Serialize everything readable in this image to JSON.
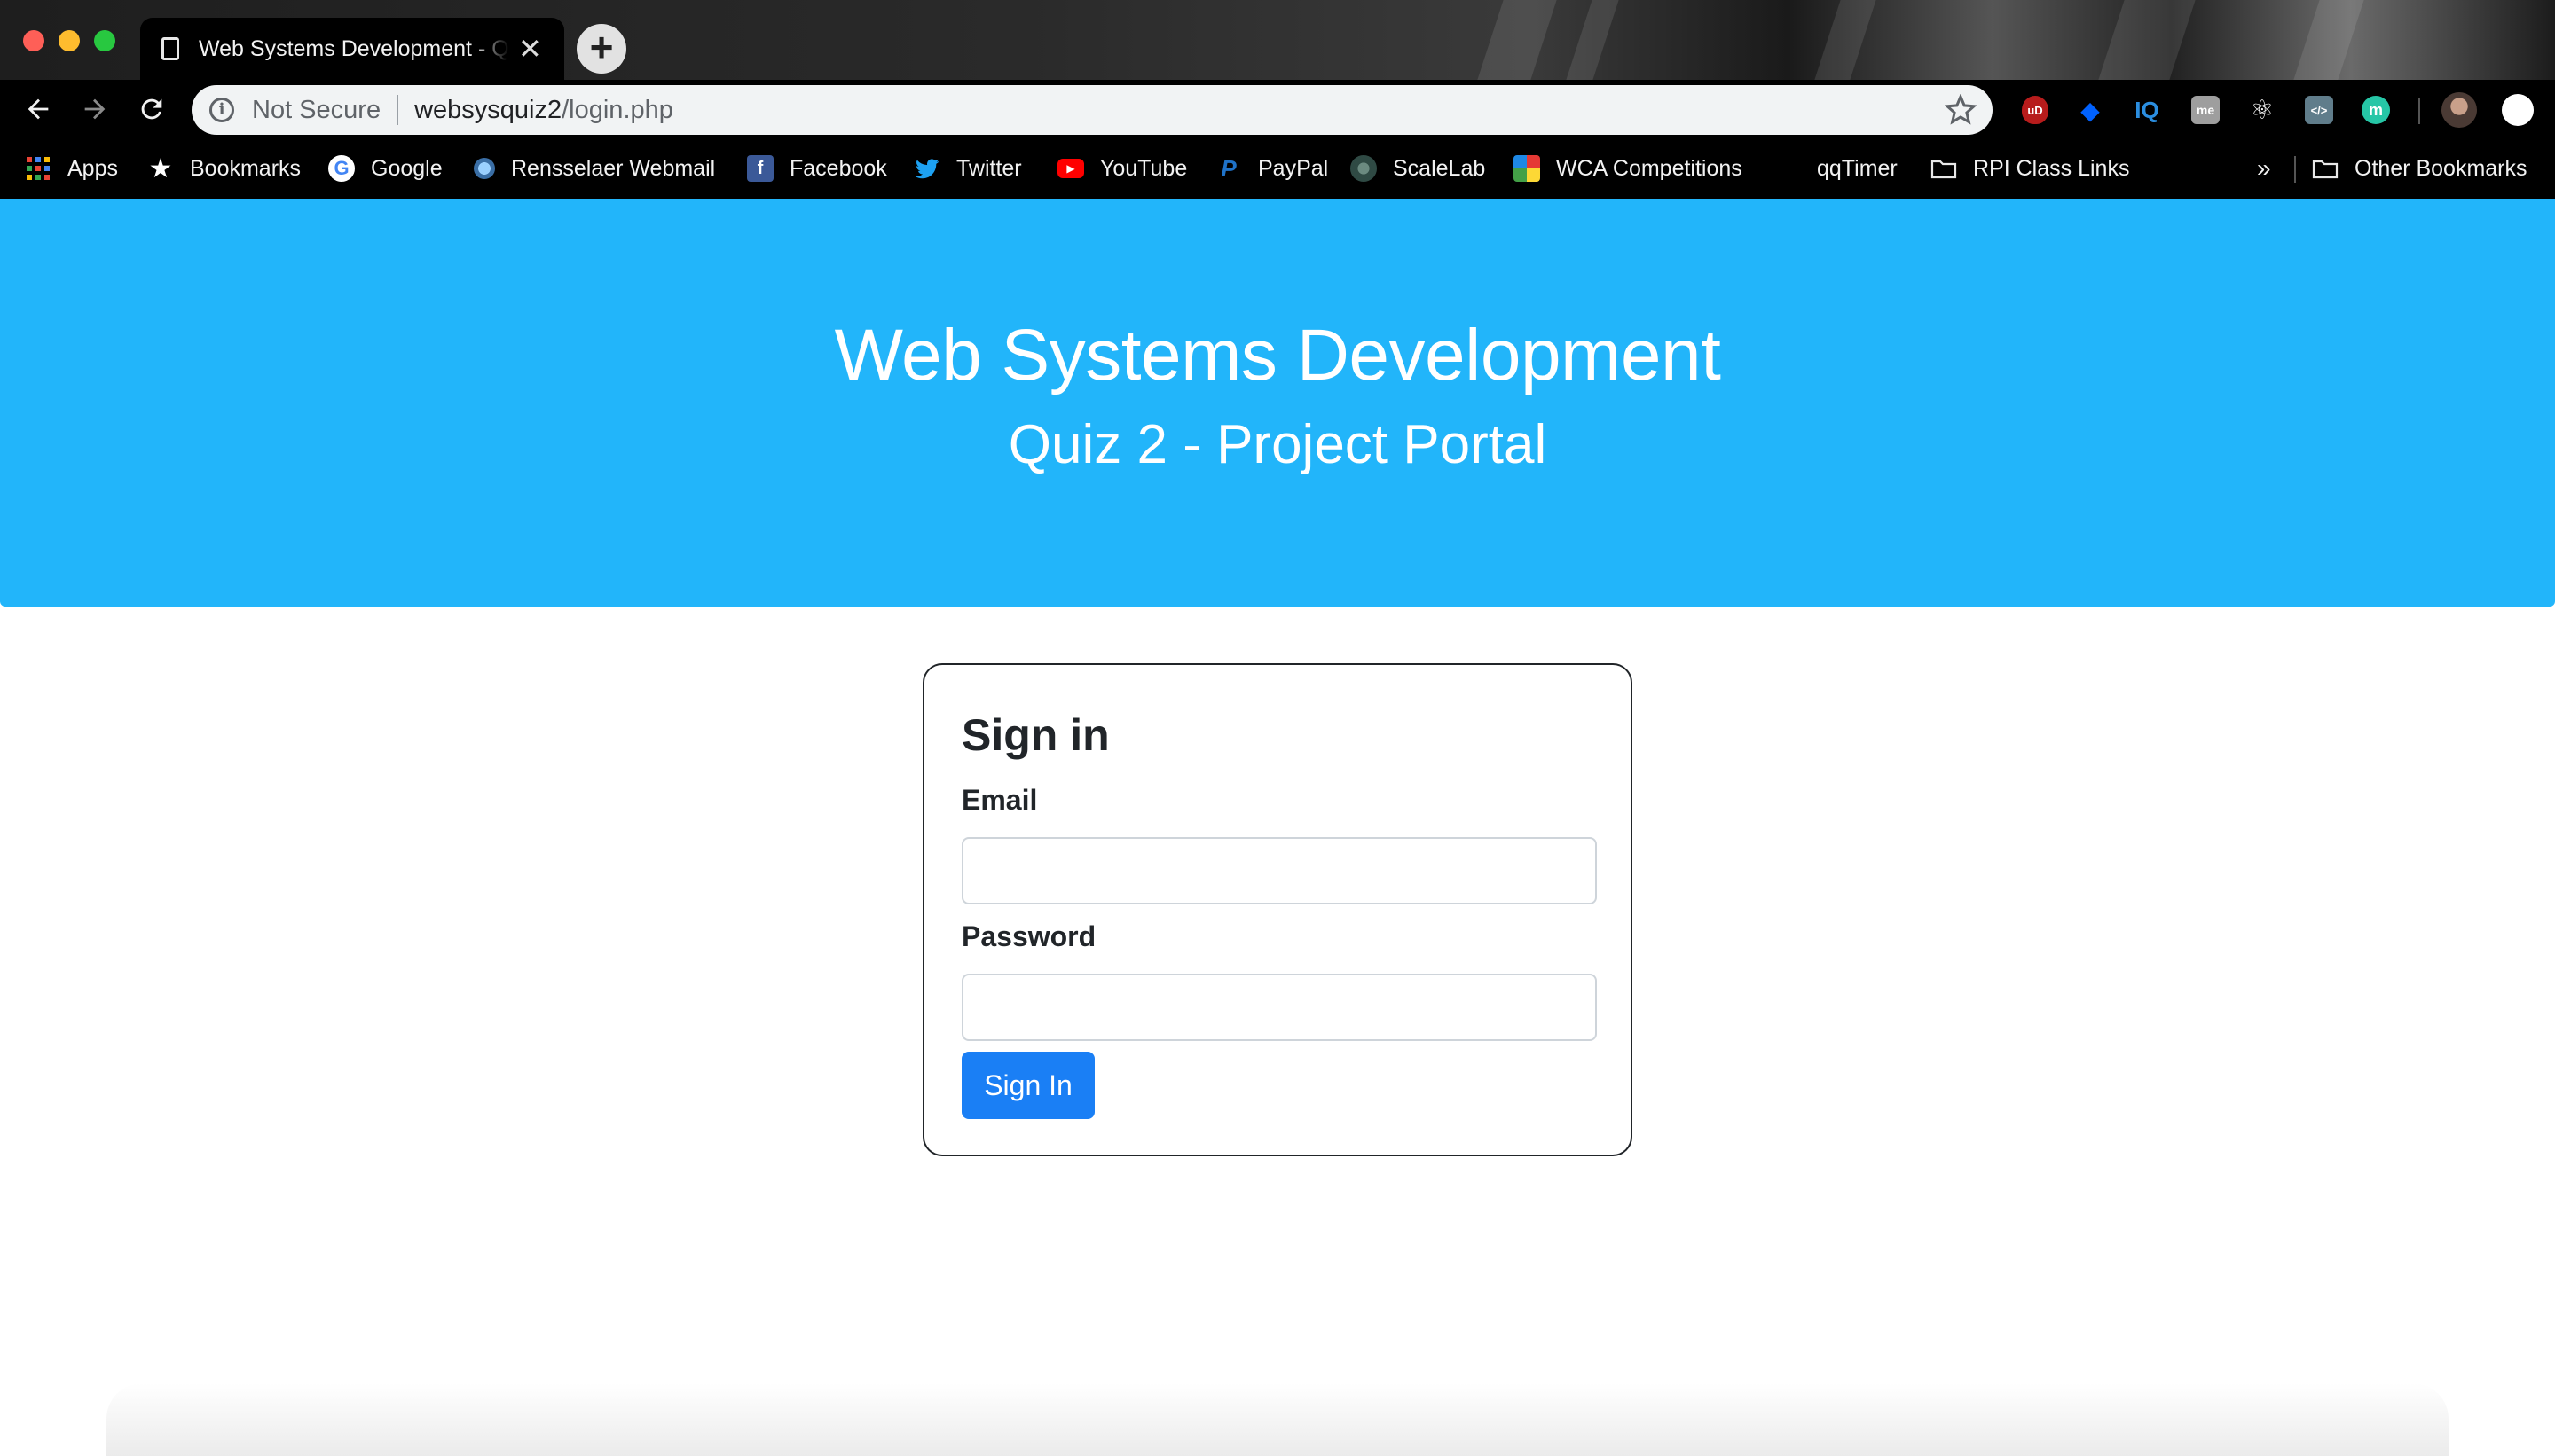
{
  "tab": {
    "title": "Web Systems Development - Q",
    "close_glyph": "✕"
  },
  "newtab_glyph": "+",
  "omnibox": {
    "security_label": "Not Secure",
    "url_host": "websysquiz2",
    "url_path": "/login.php"
  },
  "bookmarks": [
    {
      "label": "Apps",
      "icon": "apps-grid-icon"
    },
    {
      "label": "Bookmarks",
      "icon": "star-icon"
    },
    {
      "label": "Google",
      "icon": "google-icon"
    },
    {
      "label": "Rensselaer Webmail",
      "icon": "webmail-icon"
    },
    {
      "label": "Facebook",
      "icon": "facebook-icon"
    },
    {
      "label": "Twitter",
      "icon": "twitter-icon"
    },
    {
      "label": "YouTube",
      "icon": "youtube-icon"
    },
    {
      "label": "PayPal",
      "icon": "paypal-icon"
    },
    {
      "label": "ScaleLab",
      "icon": "scalelab-icon"
    },
    {
      "label": "WCA Competitions",
      "icon": "wca-icon"
    },
    {
      "label": "qqTimer",
      "icon": ""
    },
    {
      "label": "RPI Class Links",
      "icon": "folder-icon"
    },
    {
      "label": "Other Bookmarks",
      "icon": "folder-icon"
    }
  ],
  "bookmarks_overflow": "»",
  "extensions": [
    {
      "name": "ublock-icon",
      "text": "uD",
      "color": "#b71c1c"
    },
    {
      "name": "dropbox-icon",
      "text": "◆",
      "color": "#0061fe"
    },
    {
      "name": "iq-icon",
      "text": "IQ",
      "color": "#2b8ee0"
    },
    {
      "name": "me-icon",
      "text": "me",
      "color": "#9e9e9e"
    },
    {
      "name": "react-icon",
      "text": "⚛",
      "color": "#ffffff"
    },
    {
      "name": "code-icon",
      "text": "</>",
      "color": "#607d8b"
    },
    {
      "name": "m-icon",
      "text": "m",
      "color": "#26c6a6"
    }
  ],
  "hero": {
    "title": "Web Systems Development",
    "subtitle": "Quiz 2 - Project Portal"
  },
  "login": {
    "heading": "Sign in",
    "email_label": "Email",
    "email_value": "",
    "password_label": "Password",
    "password_value": "",
    "submit_label": "Sign In"
  },
  "colors": {
    "hero_bg": "#22b5fa",
    "primary_button": "#1a7ff5",
    "chrome_bg": "#000000"
  }
}
